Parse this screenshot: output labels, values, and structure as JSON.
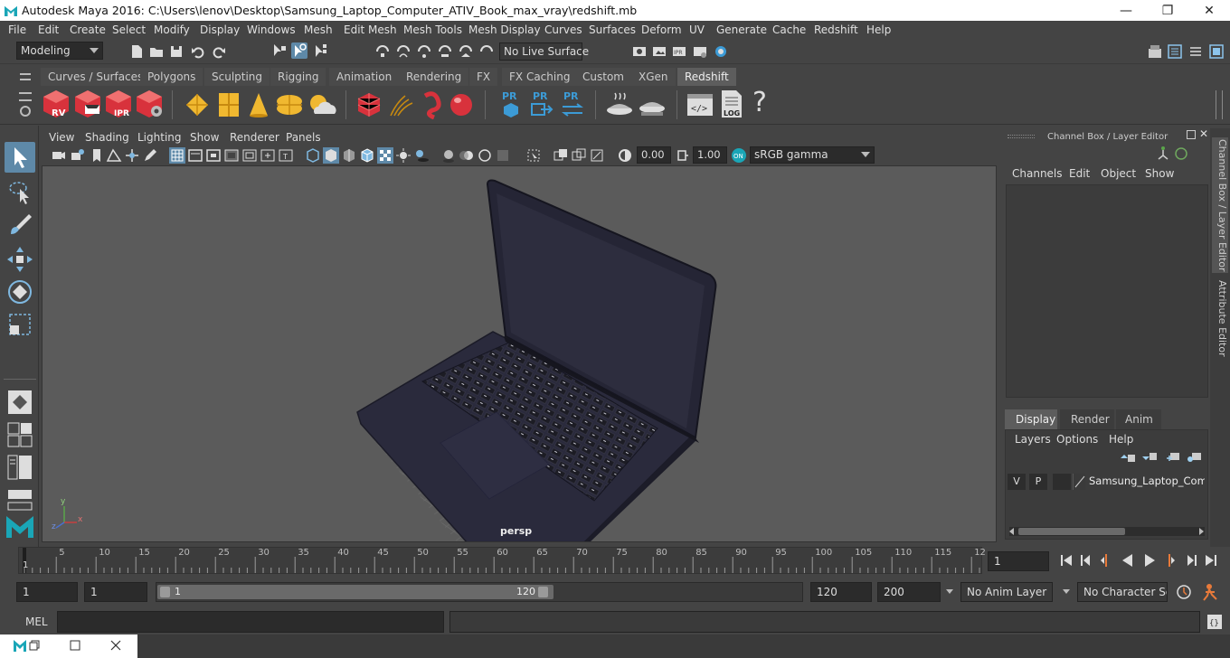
{
  "window": {
    "title": "Autodesk Maya 2016: C:\\Users\\lenov\\Desktop\\Samsung_Laptop_Computer_ATIV_Book_max_vray\\redshift.mb",
    "minimize": "—",
    "maximize": "❐",
    "close": "✕"
  },
  "menubar": [
    "File",
    "Edit",
    "Create",
    "Select",
    "Modify",
    "Display",
    "Windows",
    "Mesh",
    "Edit Mesh",
    "Mesh Tools",
    "Mesh Display",
    "Curves",
    "Surfaces",
    "Deform",
    "UV",
    "Generate",
    "Cache",
    "Redshift",
    "Help"
  ],
  "statusline": {
    "mode": "Modeling",
    "live_surface": "No Live Surface"
  },
  "shelf_tabs": [
    "Curves / Surfaces",
    "Polygons",
    "Sculpting",
    "Rigging",
    "Animation",
    "Rendering",
    "FX",
    "FX Caching",
    "Custom",
    "XGen",
    "Redshift"
  ],
  "active_shelf_tab": "Redshift",
  "shelf_labels": {
    "rv": "RV",
    "ipr": "IPR",
    "pr1": "PR",
    "pr2": "PR",
    "pr3": "PR",
    "log": "LOG",
    "help": "?"
  },
  "panel_menu": [
    "View",
    "Shading",
    "Lighting",
    "Show",
    "Renderer",
    "Panels"
  ],
  "panel_tools": {
    "exposure": "0.00",
    "gamma": "1.00",
    "color_space": "sRGB gamma"
  },
  "viewport": {
    "camera_label": "persp",
    "axis_x": "x",
    "axis_y": "y",
    "axis_z": "z"
  },
  "channel_box": {
    "header": "Channel Box / Layer Editor",
    "menu": [
      "Channels",
      "Edit",
      "Object",
      "Show"
    ]
  },
  "layer_editor": {
    "tabs": [
      "Display",
      "Render",
      "Anim"
    ],
    "active_tab": "Display",
    "menu": [
      "Layers",
      "Options",
      "Help"
    ],
    "layer": {
      "v": "V",
      "p": "P",
      "name": "Samsung_Laptop_Compu"
    }
  },
  "side_tabs": [
    "Channel Box / Layer Editor",
    "Attribute Editor"
  ],
  "timeline": {
    "ticks": [
      "5",
      "10",
      "15",
      "20",
      "25",
      "30",
      "35",
      "40",
      "45",
      "50",
      "55",
      "60",
      "65",
      "70",
      "75",
      "80",
      "85",
      "90",
      "95",
      "100",
      "105",
      "110",
      "115",
      "12"
    ],
    "start_label": "1",
    "current_frame": "1"
  },
  "range": {
    "start": "1",
    "inner_start": "1",
    "slider_start": "1",
    "slider_end": "120",
    "end": "120",
    "anim_end": "200",
    "anim_layer": "No Anim Layer",
    "character_set": "No Character Set"
  },
  "command": {
    "label": "MEL"
  },
  "colors": {
    "background": "#444444",
    "viewport": "#5b5b5b",
    "active_tab": "#5d5d5d",
    "accent_blue": "#3c9bd6",
    "accent_red": "#d8323c",
    "accent_yellow": "#f0b830"
  }
}
